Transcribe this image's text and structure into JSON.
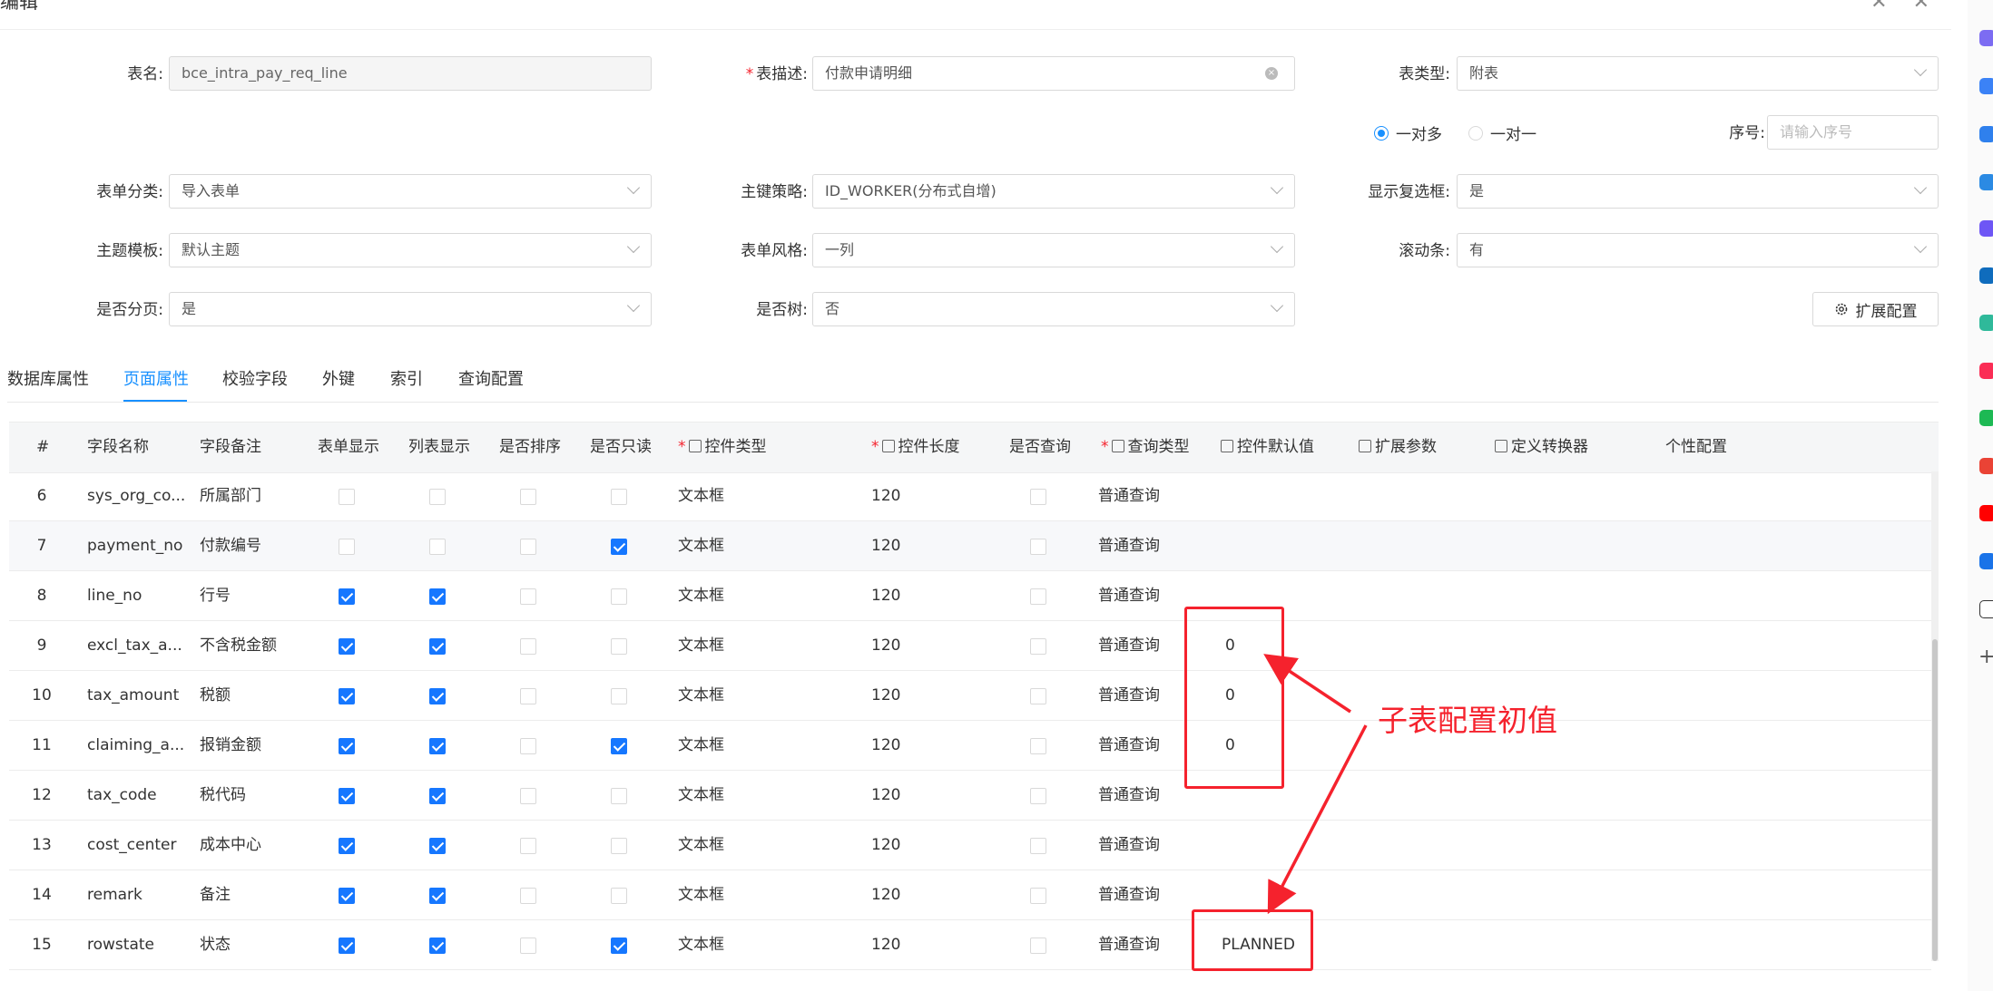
{
  "dialog": {
    "title": "编辑",
    "minimize_icon": "✕",
    "close_icon": "✕"
  },
  "form": {
    "table_name": {
      "label": "表名:",
      "value": "bce_intra_pay_req_line"
    },
    "table_desc": {
      "label": "表描述:",
      "value": "付款申请明细"
    },
    "table_type": {
      "label": "表类型:",
      "value": "附表"
    },
    "relation": {
      "one_to_many": "一对多",
      "one_to_one": "一对一",
      "selected": "一对多"
    },
    "seq": {
      "label": "序号:",
      "placeholder": "请输入序号"
    },
    "form_category": {
      "label": "表单分类:",
      "value": "导入表单"
    },
    "pk_strategy": {
      "label": "主键策略:",
      "value": "ID_WORKER(分布式自增)"
    },
    "show_checkbox": {
      "label": "显示复选框:",
      "value": "是"
    },
    "theme": {
      "label": "主题模板:",
      "value": "默认主题"
    },
    "form_style": {
      "label": "表单风格:",
      "value": "一列"
    },
    "scrollbar": {
      "label": "滚动条:",
      "value": "有"
    },
    "paging": {
      "label": "是否分页:",
      "value": "是"
    },
    "is_tree": {
      "label": "是否树:",
      "value": "否"
    },
    "ext_button": "扩展配置"
  },
  "tabs": [
    "数据库属性",
    "页面属性",
    "校验字段",
    "外键",
    "索引",
    "查询配置"
  ],
  "active_tab": "页面属性",
  "table": {
    "headers": [
      "#",
      "字段名称",
      "字段备注",
      "表单显示",
      "列表显示",
      "是否排序",
      "是否只读",
      "控件类型",
      "控件长度",
      "是否查询",
      "查询类型",
      "控件默认值",
      "扩展参数",
      "定义转换器",
      "个性配置"
    ],
    "rows": [
      {
        "no": "6",
        "name": "sys_org_co...",
        "remark": "所属部门",
        "form": false,
        "list": false,
        "sort": false,
        "readonly": false,
        "ctype": "文本框",
        "len": "120",
        "query": false,
        "qtype": "普通查询",
        "default": ""
      },
      {
        "no": "7",
        "name": "payment_no",
        "remark": "付款编号",
        "form": false,
        "list": false,
        "sort": false,
        "readonly": true,
        "ctype": "文本框",
        "len": "120",
        "query": false,
        "qtype": "普通查询",
        "default": ""
      },
      {
        "no": "8",
        "name": "line_no",
        "remark": "行号",
        "form": true,
        "list": true,
        "sort": false,
        "readonly": false,
        "ctype": "文本框",
        "len": "120",
        "query": false,
        "qtype": "普通查询",
        "default": ""
      },
      {
        "no": "9",
        "name": "excl_tax_a...",
        "remark": "不含税金额",
        "form": true,
        "list": true,
        "sort": false,
        "readonly": false,
        "ctype": "文本框",
        "len": "120",
        "query": false,
        "qtype": "普通查询",
        "default": "0"
      },
      {
        "no": "10",
        "name": "tax_amount",
        "remark": "税额",
        "form": true,
        "list": true,
        "sort": false,
        "readonly": false,
        "ctype": "文本框",
        "len": "120",
        "query": false,
        "qtype": "普通查询",
        "default": "0"
      },
      {
        "no": "11",
        "name": "claiming_a...",
        "remark": "报销金额",
        "form": true,
        "list": true,
        "sort": false,
        "readonly": true,
        "ctype": "文本框",
        "len": "120",
        "query": false,
        "qtype": "普通查询",
        "default": "0"
      },
      {
        "no": "12",
        "name": "tax_code",
        "remark": "税代码",
        "form": true,
        "list": true,
        "sort": false,
        "readonly": false,
        "ctype": "文本框",
        "len": "120",
        "query": false,
        "qtype": "普通查询",
        "default": ""
      },
      {
        "no": "13",
        "name": "cost_center",
        "remark": "成本中心",
        "form": true,
        "list": true,
        "sort": false,
        "readonly": false,
        "ctype": "文本框",
        "len": "120",
        "query": false,
        "qtype": "普通查询",
        "default": ""
      },
      {
        "no": "14",
        "name": "remark",
        "remark": "备注",
        "form": true,
        "list": true,
        "sort": false,
        "readonly": false,
        "ctype": "文本框",
        "len": "120",
        "query": false,
        "qtype": "普通查询",
        "default": ""
      },
      {
        "no": "15",
        "name": "rowstate",
        "remark": "状态",
        "form": true,
        "list": true,
        "sort": false,
        "readonly": true,
        "ctype": "文本框",
        "len": "120",
        "query": false,
        "qtype": "普通查询",
        "default": "PLANNED"
      }
    ]
  },
  "annotation": {
    "text": "子表配置初值",
    "color": "#f5222d"
  },
  "colors": {
    "accent": "#1890ff",
    "checkbox": "#1677ff",
    "annotation": "#f5222d"
  }
}
